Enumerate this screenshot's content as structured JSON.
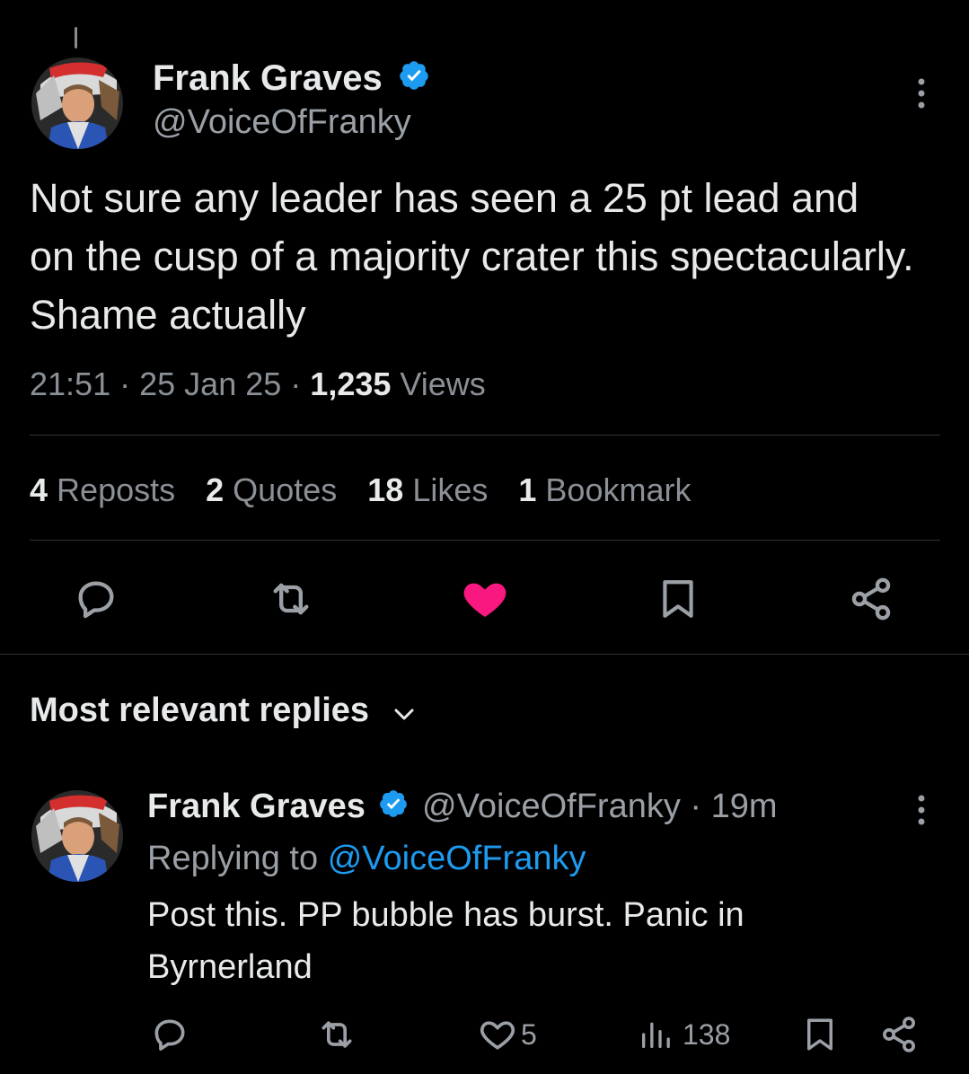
{
  "tweet": {
    "author": {
      "name": "Frank Graves",
      "handle": "@VoiceOfFranky",
      "verified": true
    },
    "text": "Not sure any leader has seen a 25 pt lead and on the cusp of a majority crater this spectacularly. Shame actually",
    "time": "21:51",
    "date": "25 Jan 25",
    "views_count": "1,235",
    "views_label": "Views",
    "stats": {
      "reposts_count": "4",
      "reposts_label": "Reposts",
      "quotes_count": "2",
      "quotes_label": "Quotes",
      "likes_count": "18",
      "likes_label": "Likes",
      "bookmarks_count": "1",
      "bookmarks_label": "Bookmark"
    },
    "liked": true,
    "accent_color": "#1d9bf0",
    "like_color": "#f91880"
  },
  "replies_section": {
    "title": "Most relevant replies"
  },
  "reply": {
    "author": {
      "name": "Frank Graves",
      "handle": "@VoiceOfFranky",
      "verified": true
    },
    "age": "19m",
    "replying_to_label": "Replying to",
    "replying_to_handle": "@VoiceOfFranky",
    "text_line1": "Post this. PP bubble has burst. Panic in",
    "text_line2": "Byrnerland",
    "likes_count": "5",
    "views_count": "138"
  }
}
